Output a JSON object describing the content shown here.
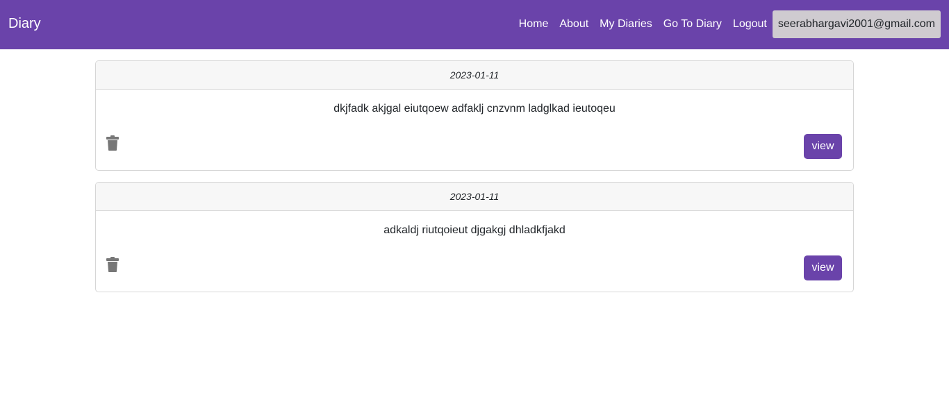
{
  "navbar": {
    "brand": "Diary",
    "links": [
      "Home",
      "About",
      "My Diaries",
      "Go To Diary",
      "Logout"
    ],
    "user_email": "seerabhargavi2001@gmail.com",
    "bg_color": "#6a43aa"
  },
  "entries": [
    {
      "date": "2023-01-11",
      "text": "dkjfadk akjgal eiutqoew adfaklj cnzvnm ladglkad ieutoqeu",
      "view_label": "view",
      "delete_icon": "trash-icon"
    },
    {
      "date": "2023-01-11",
      "text": "adkaldj riutqoieut djgakgj dhladkfjakd",
      "view_label": "view",
      "delete_icon": "trash-icon"
    }
  ]
}
